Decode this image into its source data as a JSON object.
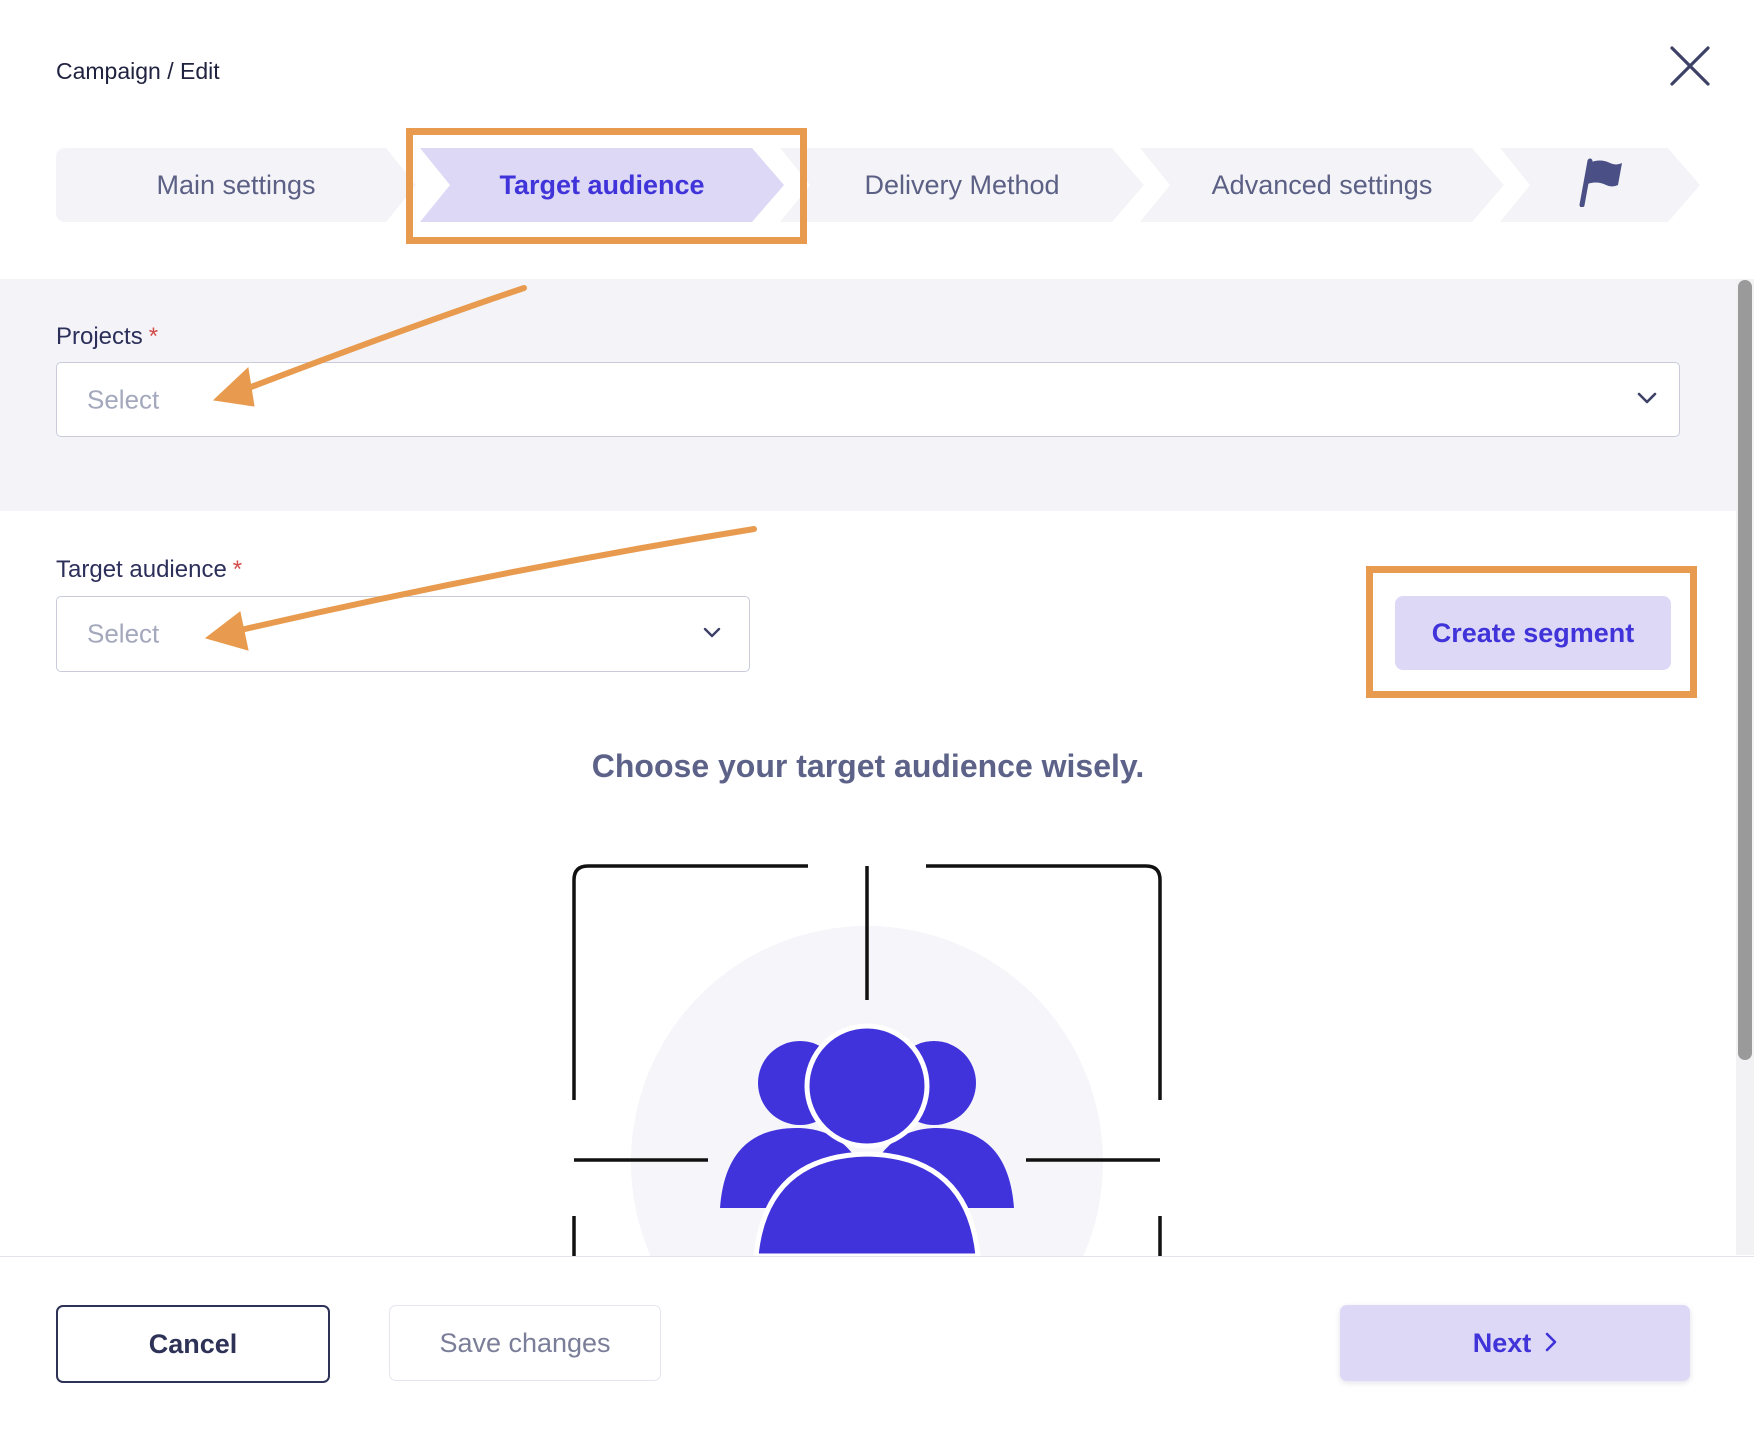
{
  "header": {
    "breadcrumb": "Campaign / Edit"
  },
  "stepper": {
    "steps": [
      {
        "label": "Main settings"
      },
      {
        "label": "Target audience",
        "active": true
      },
      {
        "label": "Delivery Method"
      },
      {
        "label": "Advanced settings"
      },
      {
        "label": "",
        "icon": "flag-icon"
      }
    ]
  },
  "form": {
    "projects": {
      "label": "Projects",
      "required_mark": "*",
      "placeholder": "Select"
    },
    "target_audience": {
      "label": "Target audience",
      "required_mark": "*",
      "placeholder": "Select"
    },
    "create_segment_label": "Create segment"
  },
  "illustration": {
    "headline": "Choose your target audience wisely.",
    "icon": "audience-group-icon"
  },
  "footer": {
    "cancel_label": "Cancel",
    "save_label": "Save changes",
    "next_label": "Next"
  },
  "colors": {
    "accent": "#3f33d9",
    "accent_soft": "#dcd8f6",
    "annotation": "#e89b4e"
  }
}
